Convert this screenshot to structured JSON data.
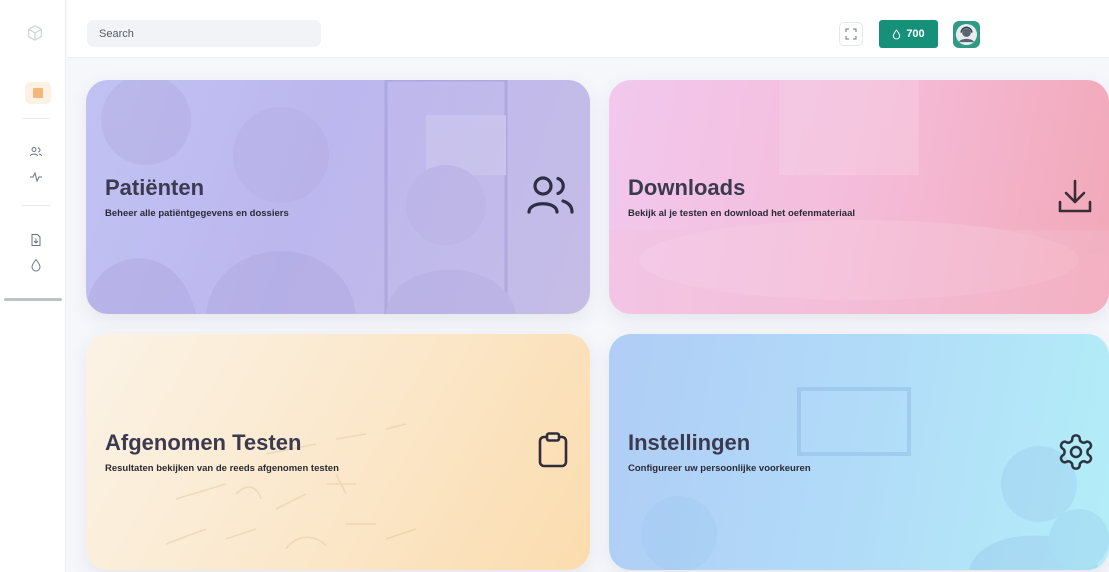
{
  "search": {
    "placeholder": "Search"
  },
  "credits": {
    "value": "700"
  },
  "sidebar": {
    "items": [
      {
        "name": "dashboard",
        "icon": "dashboard-square-icon",
        "active": true
      },
      {
        "name": "patients",
        "icon": "users-icon"
      },
      {
        "name": "activity",
        "icon": "activity-icon"
      },
      {
        "name": "downloads",
        "icon": "download-file-icon"
      },
      {
        "name": "credits",
        "icon": "drop-icon"
      }
    ]
  },
  "cards": {
    "patients": {
      "title": "Patiënten",
      "description": "Beheer alle patiëntgegevens en dossiers",
      "icon": "users-icon"
    },
    "downloads": {
      "title": "Downloads",
      "description": "Bekijk al je testen en download het oefenmateriaal",
      "icon": "download-icon"
    },
    "tests": {
      "title": "Afgenomen Testen",
      "description": "Resultaten bekijken van de reeds afgenomen testen",
      "icon": "clipboard-icon"
    },
    "settings": {
      "title": "Instellingen",
      "description": "Configureer uw persoonlijke voorkeuren",
      "icon": "gear-icon"
    }
  },
  "colors": {
    "accent": "#17907a",
    "sidebar_active": "#f2b77a",
    "patients_card": "#bcb7ee",
    "downloads_card": "#f4bcd9",
    "tests_card": "#fbe8cc",
    "settings_card": "#b1dbf8"
  }
}
